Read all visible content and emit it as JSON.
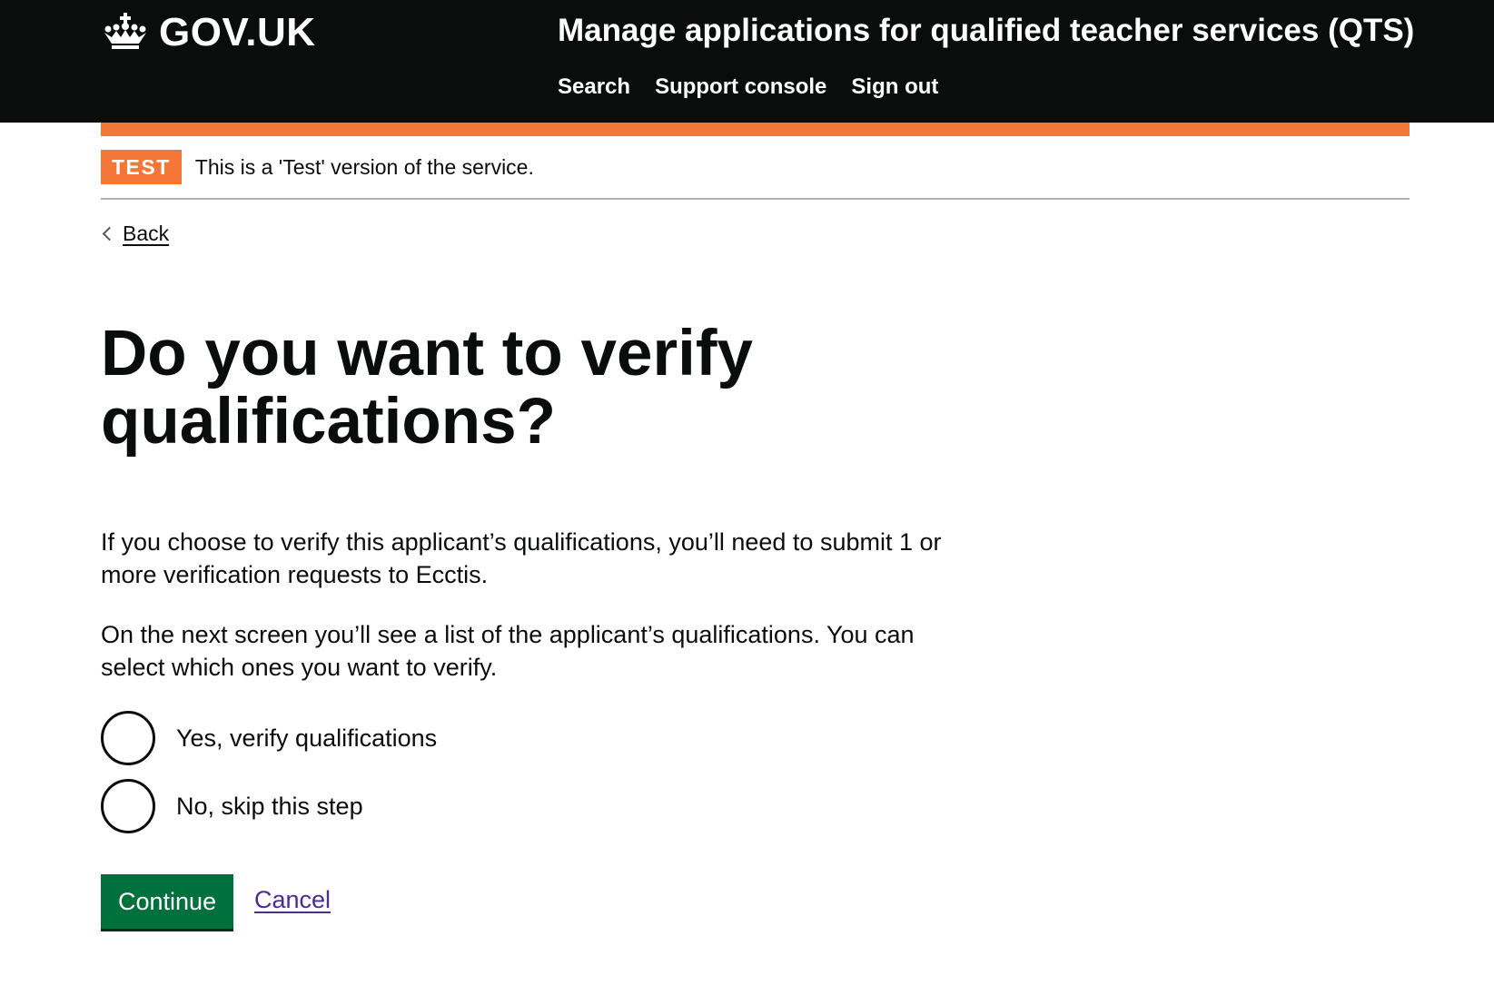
{
  "header": {
    "logo_text": "GOV.UK",
    "logo_icon": "crown-icon",
    "service_name": "Manage applications for qualified teacher services (QTS)",
    "nav": [
      {
        "label": "Search"
      },
      {
        "label": "Support console"
      },
      {
        "label": "Sign out"
      }
    ]
  },
  "phase_banner": {
    "tag": "TEST",
    "text": "This is a 'Test' version of the service."
  },
  "back_link": {
    "label": "Back",
    "icon": "chevron-left-icon"
  },
  "main": {
    "heading": "Do you want to verify qualifications?",
    "paragraphs": [
      "If you choose to verify this applicant’s qualifications, you’ll need to submit 1 or more verification requests to Ecctis.",
      "On the next screen you’ll see a list of the applicant’s qualifications. You can select which ones you want to verify."
    ],
    "options": [
      {
        "label": "Yes, verify qualifications",
        "selected": false
      },
      {
        "label": "No, skip this step",
        "selected": false
      }
    ],
    "continue_label": "Continue",
    "cancel_label": "Cancel"
  },
  "colors": {
    "header_bg": "#0b0c0c",
    "accent_orange": "#f47738",
    "button_green": "#00703c",
    "link_purple": "#4c2c92"
  }
}
